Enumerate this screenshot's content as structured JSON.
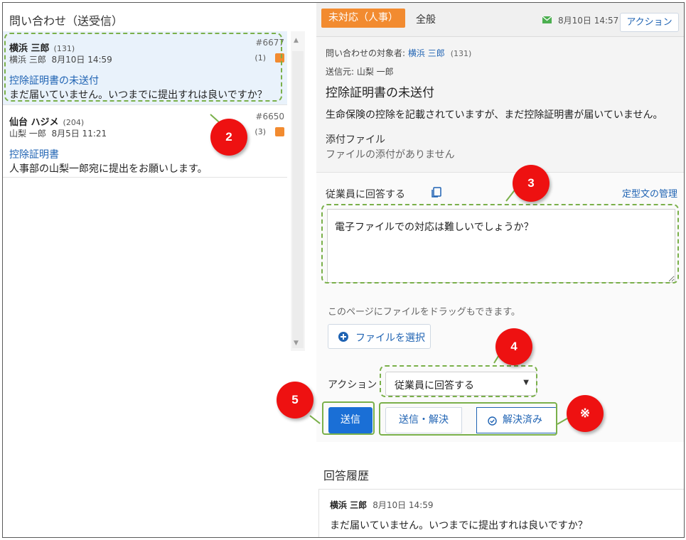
{
  "left": {
    "title": "問い合わせ（送受信）",
    "threads": [
      {
        "name": "横浜 三郎",
        "count": "(131)",
        "number": "#6677",
        "sender": "横浜 三郎",
        "date": "8月10日 14:59",
        "unread": "(1)",
        "subject": "控除証明書の未送付",
        "preview": "まだ届いていません。いつまでに提出すれは良いですか？"
      },
      {
        "name": "仙台 ハジメ",
        "count": "(204)",
        "number": "#6650",
        "sender": "山梨 一郎",
        "date": "8月5日 11:21",
        "unread": "(3)",
        "subject": "控除証明書",
        "preview": "人事部の山梨一郎宛に提出をお願いします。"
      }
    ]
  },
  "header": {
    "status": "未対応（人事）",
    "category": "全般",
    "date": "8月10日 14:57",
    "action_label": "アクション"
  },
  "detail": {
    "target_label": "問い合わせの対象者:",
    "target_name": "横浜 三郎",
    "target_count": "(131)",
    "from_line": "送信元: 山梨 一郎",
    "subject": "控除証明書の未送付",
    "body": "生命保険の控除を記載されていますが、まだ控除証明書が届いていません。",
    "attach_label": "添付ファイル",
    "attach_none": "ファイルの添付がありません"
  },
  "reply": {
    "label": "従業員に回答する",
    "template_link": "定型文の管理",
    "text": "電子ファイルでの対応は難しいでしょうか？",
    "drag_hint": "このページにファイルをドラッグもできます。",
    "file_button": "ファイルを選択",
    "action_label": "アクション",
    "action_value": "従業員に回答する",
    "send_button": "送信",
    "send_resolve_button": "送信・解決",
    "resolved_button": "解決済み"
  },
  "history": {
    "title": "回答履歴",
    "items": [
      {
        "name": "横浜 三郎",
        "date": "8月10日 14:59",
        "text": "まだ届いていません。いつまでに提出すれは良いですか？"
      }
    ]
  },
  "annotations": {
    "m2": "2",
    "m3": "3",
    "m4": "4",
    "m5": "5",
    "mx": "※"
  },
  "colors": {
    "accent": "#1f63b3",
    "status": "#f28b30",
    "callout_green": "#7ab04a",
    "marker_red": "#ee1111"
  }
}
